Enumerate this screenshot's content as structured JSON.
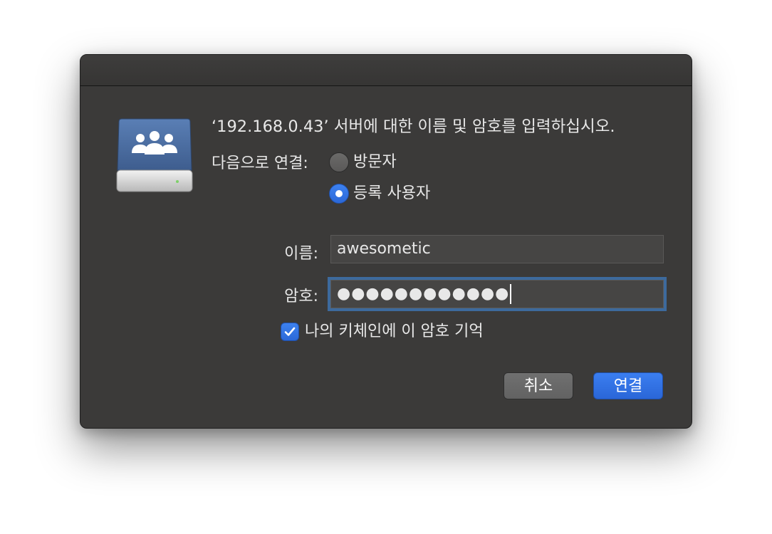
{
  "dialog": {
    "prompt": "‘192.168.0.43’ 서버에 대한 이름 및 암호를 입력하십시오.",
    "connect_as_label": "다음으로 연결:",
    "radio_guest_label": "방문자",
    "radio_registered_label": "등록 사용자",
    "selected_option": "등록 사용자",
    "name_label": "이름:",
    "name_value": "awesometic",
    "password_label": "암호:",
    "password_masked": "●●●●●●●●●●●●",
    "remember_label": "나의 키체인에 이 암호 기억",
    "remember_checked": true,
    "cancel_label": "취소",
    "connect_label": "연결"
  },
  "icons": {
    "server": "server-drive-icon",
    "users": "users-group-icon"
  },
  "colors": {
    "accent": "#2b6ee0",
    "dialog_bg": "#3b3a39",
    "focus_ring": "#3d6a9d"
  }
}
